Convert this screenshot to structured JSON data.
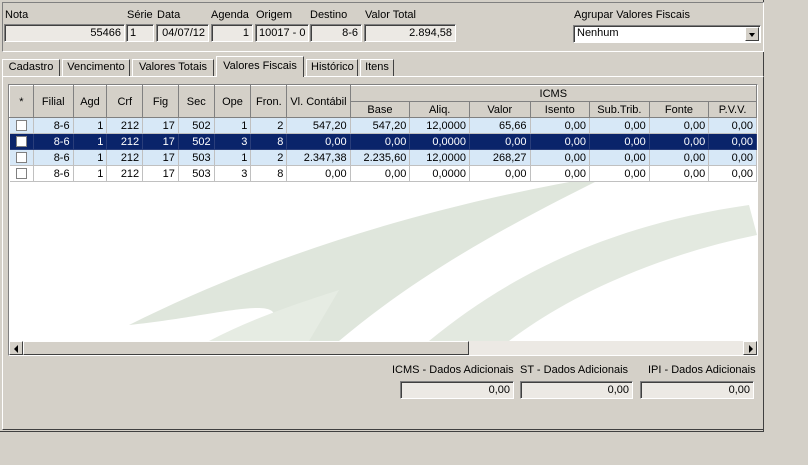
{
  "header": {
    "nota": {
      "label": "Nota",
      "value": "55466"
    },
    "serie": {
      "label": "Série",
      "value": "1"
    },
    "data": {
      "label": "Data",
      "value": "04/07/12"
    },
    "agenda": {
      "label": "Agenda",
      "value": "1"
    },
    "origem": {
      "label": "Origem",
      "value": "10017 - 0"
    },
    "destino": {
      "label": "Destino",
      "value": "8-6"
    },
    "valor_total": {
      "label": "Valor Total",
      "value": "2.894,58"
    },
    "agrupar": {
      "label": "Agrupar Valores Fiscais",
      "value": "Nenhum"
    }
  },
  "tabs": [
    {
      "label": "Cadastro"
    },
    {
      "label": "Vencimento"
    },
    {
      "label": "Valores Totais"
    },
    {
      "label": "Valores Fiscais",
      "active": true
    },
    {
      "label": "Histórico"
    },
    {
      "label": "Itens"
    }
  ],
  "grid": {
    "group_header": "ICMS",
    "columns": [
      "*",
      "Filial",
      "Agd",
      "Crf",
      "Fig",
      "Sec",
      "Ope",
      "Fron.",
      "Vl. Contábil",
      "Base",
      "Aliq.",
      "Valor",
      "Isento",
      "Sub.Trib.",
      "Fonte",
      "P.V.V."
    ],
    "rows": [
      {
        "cells": [
          "8-6",
          "1",
          "212",
          "17",
          "502",
          "1",
          "2",
          "547,20",
          "547,20",
          "12,0000",
          "65,66",
          "0,00",
          "0,00",
          "0,00",
          "0,00"
        ],
        "style": "light"
      },
      {
        "cells": [
          "8-6",
          "1",
          "212",
          "17",
          "502",
          "3",
          "8",
          "0,00",
          "0,00",
          "0,0000",
          "0,00",
          "0,00",
          "0,00",
          "0,00",
          "0,00"
        ],
        "style": "selected"
      },
      {
        "cells": [
          "8-6",
          "1",
          "212",
          "17",
          "503",
          "1",
          "2",
          "2.347,38",
          "2.235,60",
          "12,0000",
          "268,27",
          "0,00",
          "0,00",
          "0,00",
          "0,00"
        ],
        "style": "light"
      },
      {
        "cells": [
          "8-6",
          "1",
          "212",
          "17",
          "503",
          "3",
          "8",
          "0,00",
          "0,00",
          "0,0000",
          "0,00",
          "0,00",
          "0,00",
          "0,00",
          "0,00"
        ],
        "style": "white"
      }
    ]
  },
  "footer": {
    "icms": {
      "label": "ICMS - Dados Adicionais",
      "value": "0,00"
    },
    "st": {
      "label": "ST - Dados Adicionais",
      "value": "0,00"
    },
    "ipi": {
      "label": "IPI - Dados Adicionais",
      "value": "0,00"
    }
  },
  "colors": {
    "selected_row": "#0a246a",
    "alt_row": "#d7e8f7",
    "watermark": "#dfe6dc"
  }
}
